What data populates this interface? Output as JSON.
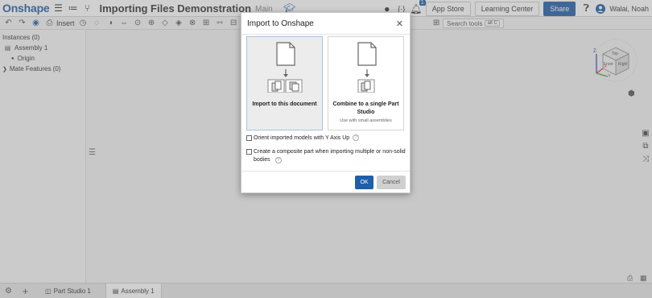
{
  "header": {
    "logo": "Onshape",
    "document_title": "Importing Files Demonstration",
    "workspace": "Main",
    "notification_count": "1",
    "app_store": "App Store",
    "learning_center": "Learning Center",
    "share": "Share",
    "user_name": "Walai, Noah"
  },
  "toolbar": {
    "insert_label": "Insert",
    "search_tools": "Search tools",
    "search_shortcut": "alt C"
  },
  "left_panel": {
    "instances": "Instances (0)",
    "assembly": "Assembly 1",
    "origin": "Origin",
    "mate_features": "Mate Features (0)"
  },
  "view_cube": {
    "top": "Top",
    "front": "Front",
    "right": "Right",
    "axis_x": "X",
    "axis_y": "Y",
    "axis_z": "Z"
  },
  "bottom_tabs": [
    {
      "label": "Part Studio 1",
      "active": false
    },
    {
      "label": "Assembly 1",
      "active": true
    }
  ],
  "dialog": {
    "title": "Import to Onshape",
    "option1_label": "Import to this document",
    "option2_label": "Combine to a single Part Studio",
    "option2_sub": "Use with small assemblies",
    "check1": "Orient imported models with Y Axis Up",
    "check2": "Create a composite part when importing multiple or non-solid bodies",
    "ok": "OK",
    "cancel": "Cancel"
  },
  "colors": {
    "brand": "#1f5ea8",
    "overlay": "rgba(120,120,120,0.35)"
  },
  "icons": [
    "hamburger-icon",
    "features-icon",
    "branch-icon",
    "chat-icon",
    "function-icon",
    "bell-icon",
    "help-icon",
    "avatar-icon",
    "undo-icon",
    "redo-icon",
    "file-icon",
    "close-icon"
  ]
}
